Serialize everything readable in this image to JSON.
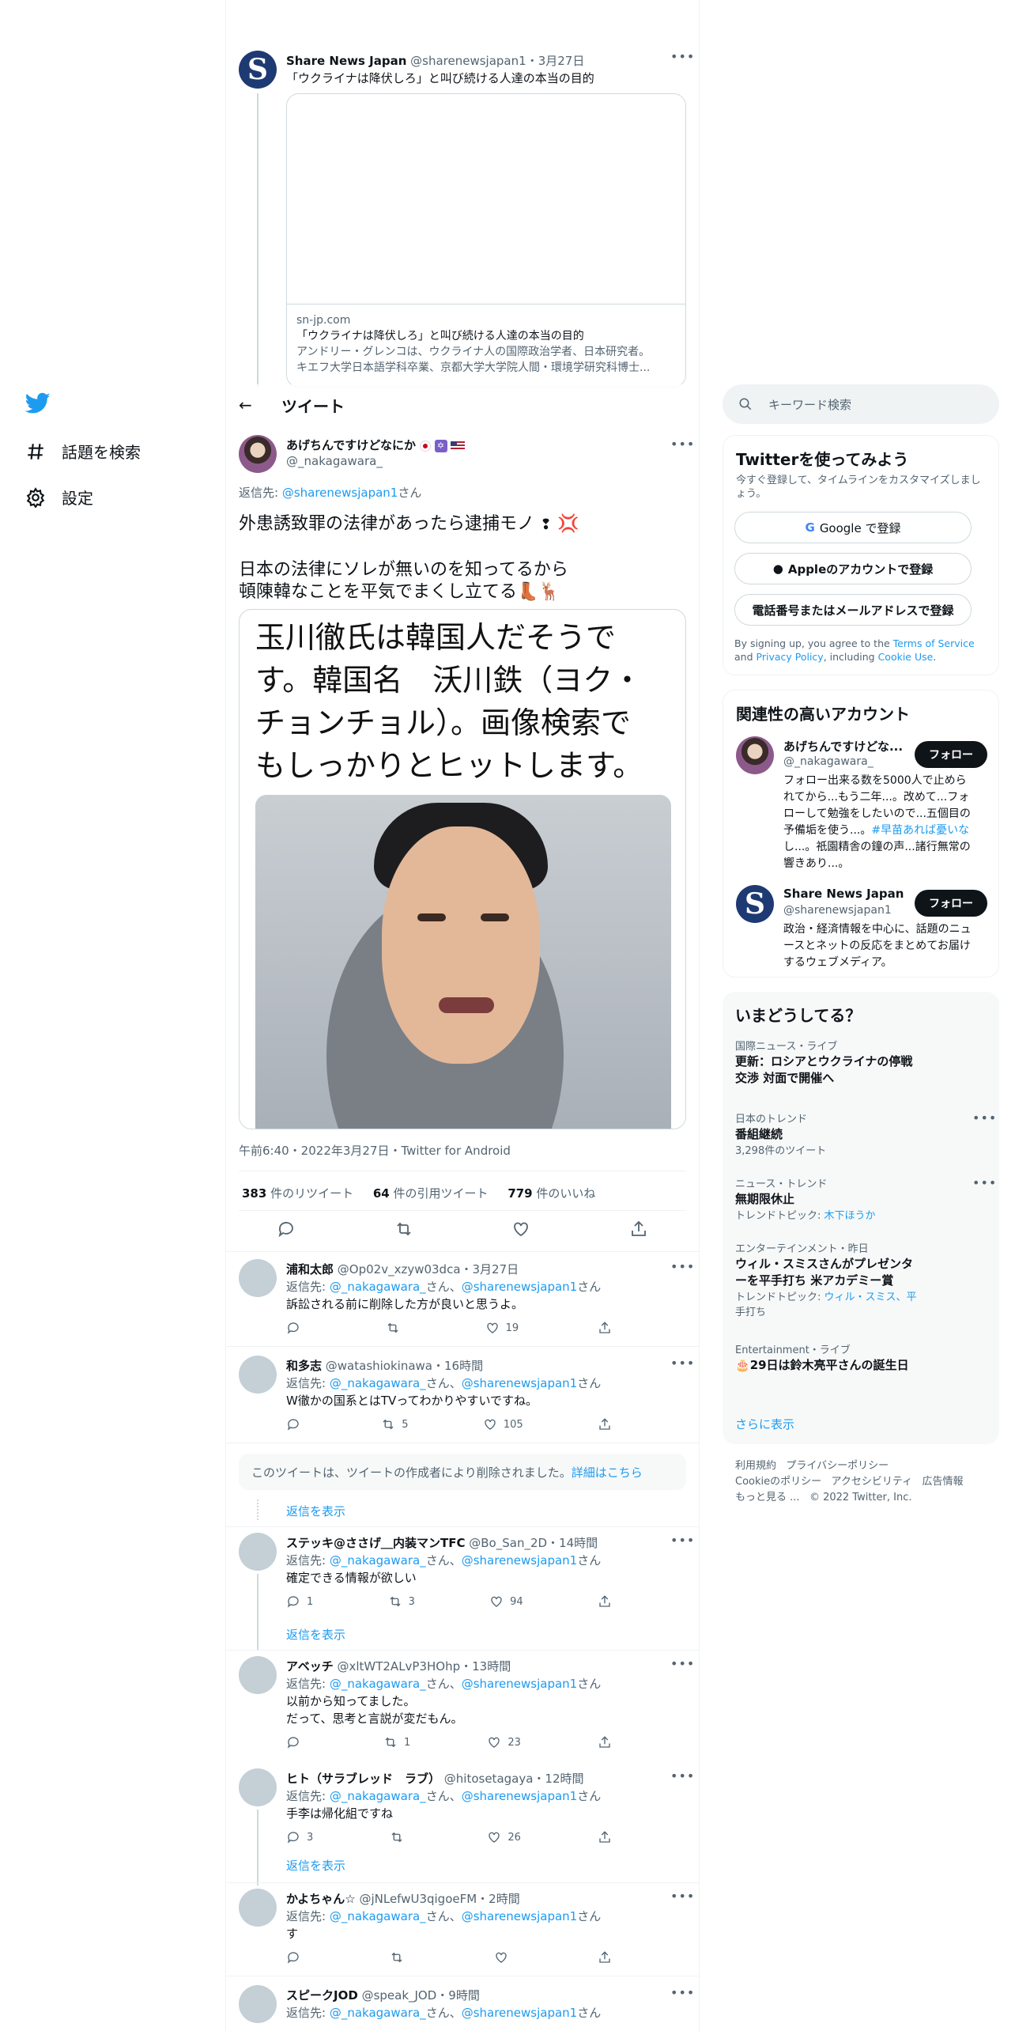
{
  "nav": {
    "search_label": "話題を検索",
    "settings_label": "設定"
  },
  "quoted_tweet": {
    "name": "Share News Japan",
    "handle": "@sharenewsjapan1",
    "time": "3月27日",
    "text": "「ウクライナは降伏しろ」と叫び続ける人達の本当の目的",
    "card": {
      "domain": "sn-jp.com",
      "title": "「ウクライナは降伏しろ」と叫び続ける人達の本当の目的",
      "desc1": "アンドリー・グレンコは、ウクライナ人の国際政治学者、日本研究者。",
      "desc2": "キエフ大学日本語学科卒業、京都大学大学院人間・環境学研究科博士..."
    }
  },
  "header": {
    "back": "←",
    "title": "ツイート"
  },
  "main_tweet": {
    "name": "あげちんですけどなにか",
    "handle": "@_nakagawara_",
    "reply_prefix": "返信先: ",
    "reply_to": "@sharenewsjapan1",
    "reply_suffix": "さん",
    "line1": "外患誘致罪の法律があったら逮捕モノ",
    "line2": "日本の法律にソレが無いのを知ってるから",
    "line3": "頓陳韓なことを平気でまくし立てる",
    "image_text": [
      "玉川徹氏は韓国人だそうで",
      "す。韓国名　沃川鉄（ヨク・",
      "チョンチョル）。画像検索で",
      "もしっかりとヒットします。"
    ],
    "meta": "午前6:40・2022年3月27日・Twitter for Android",
    "stats": {
      "retweets_num": "383",
      "retweets_label": " 件のリツイート",
      "quotes_num": "64",
      "quotes_label": " 件の引用ツイート",
      "likes_num": "779",
      "likes_label": " 件のいいね"
    }
  },
  "replies": [
    {
      "name": "浦和太郎",
      "handle": "@Op02v_xzyw03dca",
      "time": "3月27日",
      "to1": "@_nakagawara_",
      "to2": "@sharenewsjapan1",
      "text": "訴訟される前に削除した方が良いと思うよ。",
      "rt": "",
      "like": "19"
    },
    {
      "name": "和多志",
      "handle": "@watashiokinawa",
      "time": "16時間",
      "to1": "@_nakagawara_",
      "to2": "@sharenewsjapan1",
      "text": "W徹かの国系とはTVってわかりやすいですね。",
      "rt": "5",
      "like": "105"
    },
    {
      "name": "ステッキ@ささげ＿内装マンTFC",
      "handle": "@Bo_San_2D",
      "time": "14時間",
      "to1": "@_nakagawara_",
      "to2": "@sharenewsjapan1",
      "text": "確定できる情報が欲しい",
      "reply": "1",
      "rt": "3",
      "like": "94"
    },
    {
      "name": "アベッチ",
      "handle": "@xltWT2ALvP3HOhp",
      "time": "13時間",
      "to1": "@_nakagawara_",
      "to2": "@sharenewsjapan1",
      "text": "以前から知ってました。",
      "text2": "だって、思考と言説が変だもん。",
      "rt": "1",
      "like": "23"
    },
    {
      "name": "ヒト（サラブレッド　ラブ）",
      "handle": "@hitosetagaya",
      "time": "12時間",
      "to1": "@_nakagawara_",
      "to2": "@sharenewsjapan1",
      "text": "手李は帰化組ですね",
      "reply": "3",
      "rt": "",
      "like": "26"
    },
    {
      "name": "かよちゃん☆",
      "handle": "@jNLefwU3qigoeFM",
      "time": "2時間",
      "to1": "@_nakagawara_",
      "to2": "@sharenewsjapan1",
      "text": "す"
    },
    {
      "name": "スピークJOD",
      "handle": "@speak_JOD",
      "time": "9時間",
      "to1": "@_nakagawara_",
      "to2": "@sharenewsjapan1"
    }
  ],
  "reply_common": {
    "prefix": "返信先: ",
    "san": "さん",
    "sep": "さん、"
  },
  "deleted": {
    "text": "このツイートは、ツイートの作成者により削除されました。",
    "link": "詳細はこちら"
  },
  "show_replies": "返信を表示",
  "right": {
    "search_placeholder": "キーワード検索",
    "signup": {
      "title": "Twitterを使ってみよう",
      "subtitle": "今すぐ登録して、タイムラインをカスタマイズしましょう。",
      "google": "Google で登録",
      "apple": "Appleのアカウントで登録",
      "phone": "電話番号またはメールアドレスで登録",
      "terms_a": "By signing up, you agree to the ",
      "terms_link1": "Terms of Service",
      "terms_b": " and",
      "terms_link2": "Privacy Policy",
      "terms_c": ", including ",
      "terms_link3": "Cookie Use",
      "terms_d": "."
    },
    "related": {
      "title": "関連性の高いアカウント",
      "follow": "フォロー",
      "accounts": [
        {
          "name": "あげちんですけどな...",
          "handle": "@_nakagawara_",
          "bio": [
            "フォロー出来る数を5000人で止めら",
            "れてから...もう二年...。改めて...フォ",
            "ローして勉強をしたいので...五個目の",
            "予備垢を使う...。",
            "し...。祇園精舎の鐘の声...諸行無常の",
            "響きあり...。"
          ],
          "bio_link_a": "#早苗あれば憂いな"
        },
        {
          "name": "Share News Japan",
          "handle": "@sharenewsjapan1",
          "bio": [
            "政治・経済情報を中心に、話題のニュ",
            "ースとネットの反応をまとめてお届け",
            "するウェブメディア。"
          ]
        }
      ]
    },
    "trends": {
      "title": "いまどうしてる？",
      "items": [
        {
          "cat": "国際ニュース・ライブ",
          "title1": "更新：ロシアとウクライナの停戦",
          "title2": "交渉 対面で開催へ"
        },
        {
          "cat": "日本のトレンド",
          "title1": "番組継続",
          "count": "3,298件のツイート"
        },
        {
          "cat": "ニュース・トレンド",
          "title1": "無期限休止",
          "topic_label": "トレンドトピック: ",
          "topic": "木下ほうか"
        },
        {
          "cat": "エンターテインメント・昨日",
          "title1": "ウィル・スミスさんがプレゼンタ",
          "title2": "ーを平手打ち 米アカデミー賞",
          "topic_label": "トレンドトピック: ",
          "topic": "ウィル・スミス、平",
          "topic2": "手打ち"
        },
        {
          "cat": "Entertainment・ライブ",
          "title1": "29日は鈴木亮平さんの誕生日"
        }
      ],
      "more": "さらに表示"
    },
    "footer": {
      "line1a": "利用規約",
      "line1b": "プライバシーポリシー",
      "line2a": "Cookieのポリシー",
      "line2b": "アクセシビリティ",
      "line2c": "広告情報",
      "line3a": "もっと見る ...",
      "line3b": "© 2022 Twitter, Inc."
    }
  },
  "colors": {
    "accent": "#1d9bf0",
    "text": "#0f1419",
    "muted": "#536471"
  }
}
